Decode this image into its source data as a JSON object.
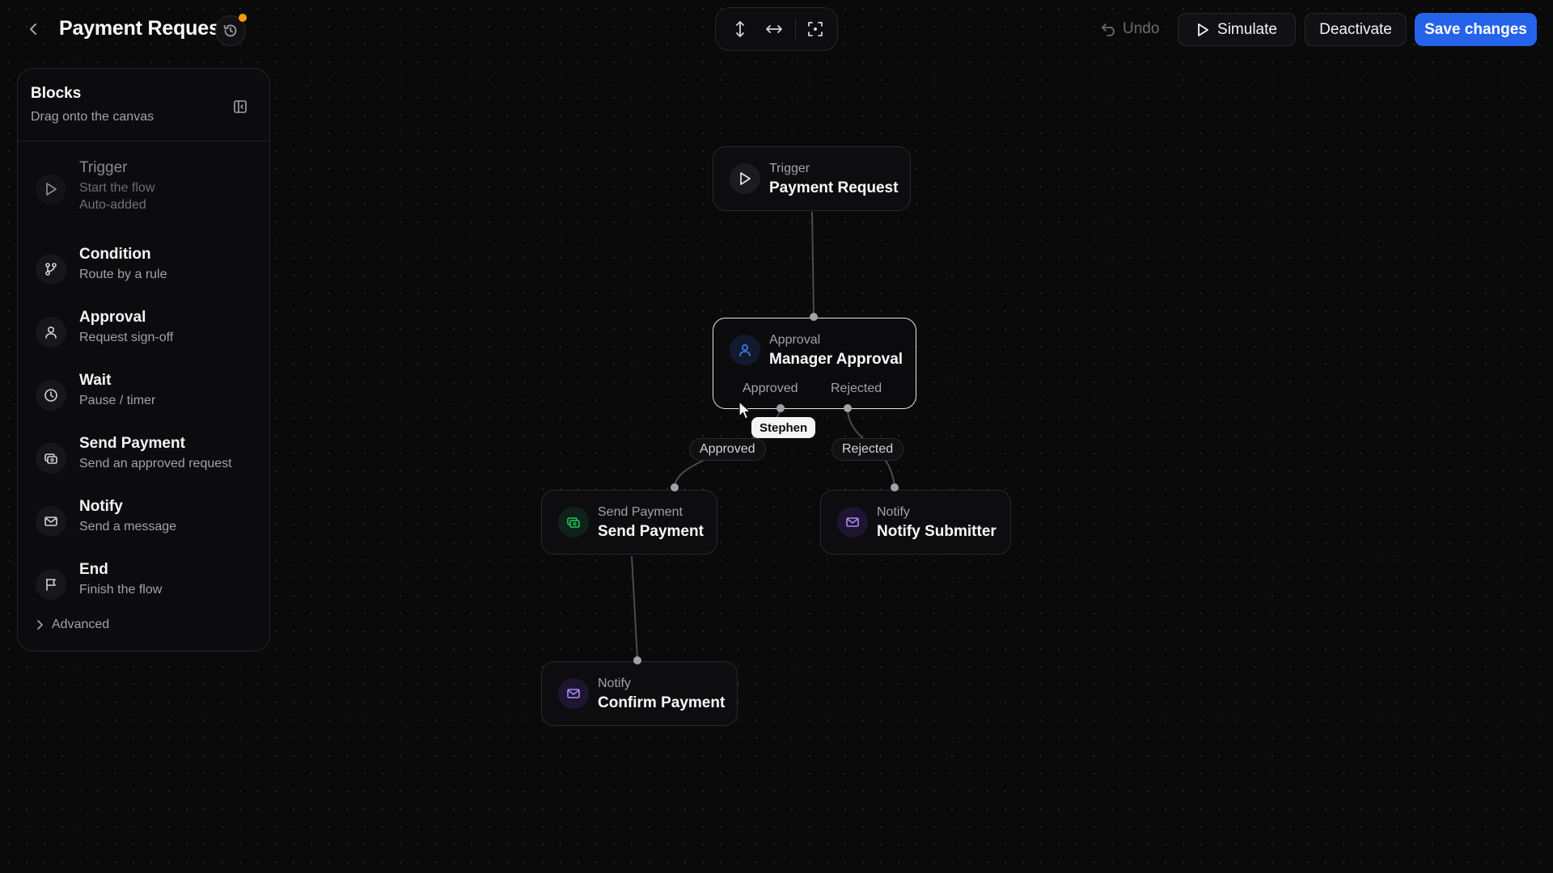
{
  "header": {
    "title": "Payment Request",
    "undo_label": "Undo",
    "simulate_label": "Simulate",
    "deactivate_label": "Deactivate",
    "save_label": "Save changes",
    "history_indicator_color": "#f59e0b",
    "accent_color": "#2563eb"
  },
  "sidebar": {
    "title": "Blocks",
    "subtitle": "Drag onto the canvas",
    "items": [
      {
        "name": "Trigger",
        "desc": "Start the flow",
        "note": "Auto-added",
        "icon": "play-icon"
      },
      {
        "name": "Condition",
        "desc": "Route by a rule",
        "icon": "branch-icon"
      },
      {
        "name": "Approval",
        "desc": "Request sign-off",
        "icon": "user-icon"
      },
      {
        "name": "Wait",
        "desc": "Pause / timer",
        "icon": "clock-icon"
      },
      {
        "name": "Send Payment",
        "desc": "Send an approved request",
        "icon": "payment-icon"
      },
      {
        "name": "Notify",
        "desc": "Send a message",
        "icon": "mail-icon"
      },
      {
        "name": "End",
        "desc": "Finish the flow",
        "icon": "flag-icon"
      }
    ],
    "advanced_label": "Advanced"
  },
  "canvas": {
    "nodes": {
      "trigger": {
        "type": "Trigger",
        "label": "Payment Request"
      },
      "approval": {
        "type": "Approval",
        "label": "Manager Approval",
        "branches": [
          "Approved",
          "Rejected"
        ]
      },
      "send_payment": {
        "type": "Send Payment",
        "label": "Send Payment"
      },
      "notify_submitter": {
        "type": "Notify",
        "label": "Notify Submitter"
      },
      "confirm_payment": {
        "type": "Notify",
        "label": "Confirm Payment"
      }
    },
    "edge_labels": {
      "approved": "Approved",
      "rejected": "Rejected"
    },
    "cursor_user": "Stephen"
  }
}
